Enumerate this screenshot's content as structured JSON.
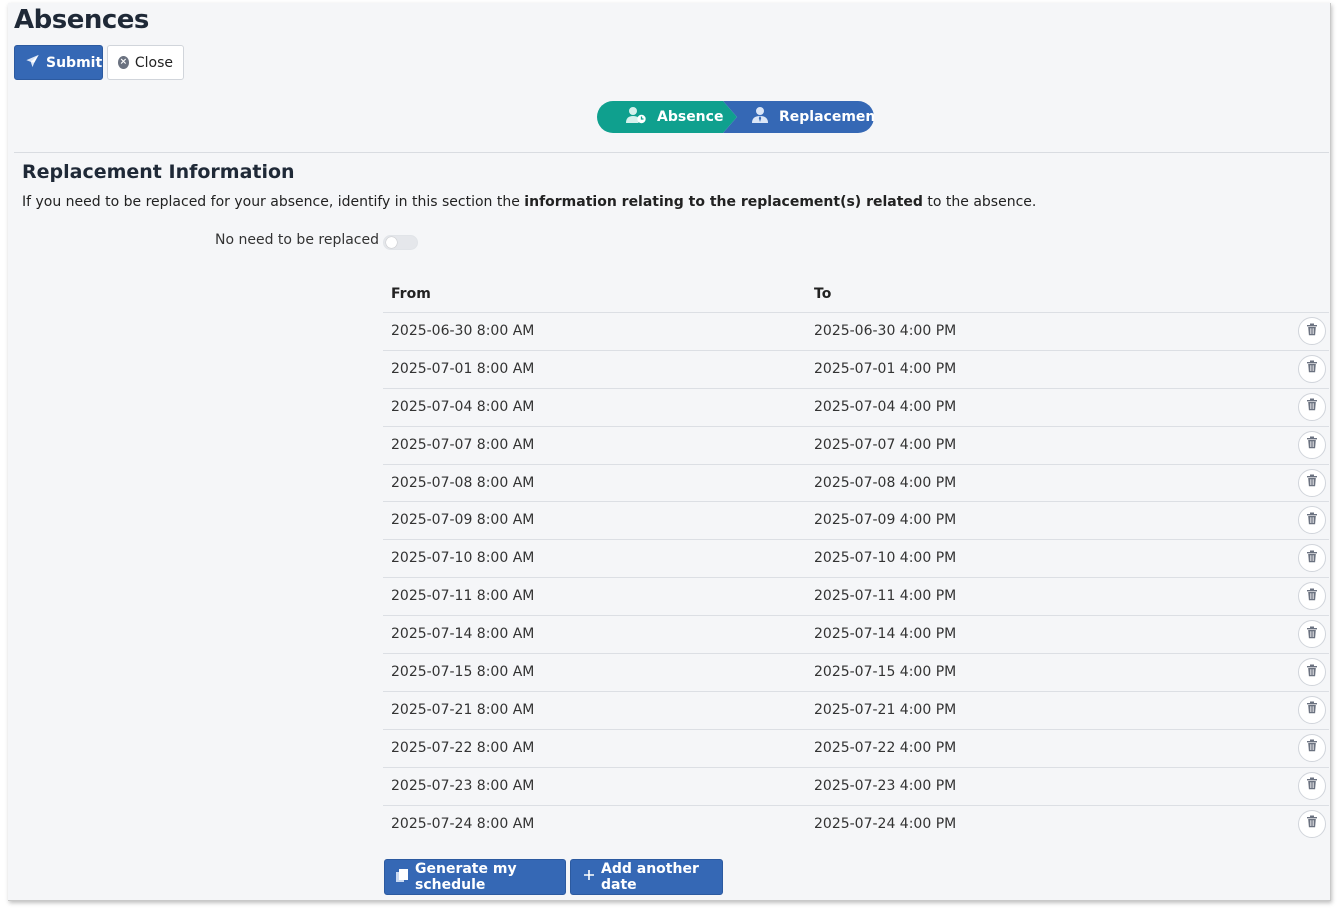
{
  "page": {
    "title": "Absences"
  },
  "toolbar": {
    "submit_label": "Submit",
    "close_label": "Close"
  },
  "stepper": {
    "step1_label": "Absence",
    "step2_label": "Replacement"
  },
  "section": {
    "title": "Replacement Information",
    "desc_prefix": "If you need to be replaced for your absence, identify in this section the ",
    "desc_bold": "information relating to the replacement(s) related",
    "desc_suffix": " to the absence."
  },
  "toggle": {
    "label": "No need to be replaced",
    "checked": false
  },
  "table": {
    "headers": {
      "from": "From",
      "to": "To"
    },
    "rows": [
      {
        "from": "2025-06-30 8:00 AM",
        "to": "2025-06-30 4:00 PM"
      },
      {
        "from": "2025-07-01 8:00 AM",
        "to": "2025-07-01 4:00 PM"
      },
      {
        "from": "2025-07-04 8:00 AM",
        "to": "2025-07-04 4:00 PM"
      },
      {
        "from": "2025-07-07 8:00 AM",
        "to": "2025-07-07 4:00 PM"
      },
      {
        "from": "2025-07-08 8:00 AM",
        "to": "2025-07-08 4:00 PM"
      },
      {
        "from": "2025-07-09 8:00 AM",
        "to": "2025-07-09 4:00 PM"
      },
      {
        "from": "2025-07-10 8:00 AM",
        "to": "2025-07-10 4:00 PM"
      },
      {
        "from": "2025-07-11 8:00 AM",
        "to": "2025-07-11 4:00 PM"
      },
      {
        "from": "2025-07-14 8:00 AM",
        "to": "2025-07-14 4:00 PM"
      },
      {
        "from": "2025-07-15 8:00 AM",
        "to": "2025-07-15 4:00 PM"
      },
      {
        "from": "2025-07-21 8:00 AM",
        "to": "2025-07-21 4:00 PM"
      },
      {
        "from": "2025-07-22 8:00 AM",
        "to": "2025-07-22 4:00 PM"
      },
      {
        "from": "2025-07-23 8:00 AM",
        "to": "2025-07-23 4:00 PM"
      },
      {
        "from": "2025-07-24 8:00 AM",
        "to": "2025-07-24 4:00 PM"
      }
    ]
  },
  "actions": {
    "generate_label": "Generate my schedule",
    "add_label": "Add another date"
  },
  "colors": {
    "primary": "#3568b5",
    "step_done": "#0fa08e",
    "background": "#f5f6f8"
  },
  "icons": {
    "submit": "paper-plane-icon",
    "close": "close-circle-icon",
    "absence": "user-clock-icon",
    "replacement": "user-tie-icon",
    "delete": "trash-icon",
    "generate": "copy-icon",
    "add": "plus-icon"
  }
}
